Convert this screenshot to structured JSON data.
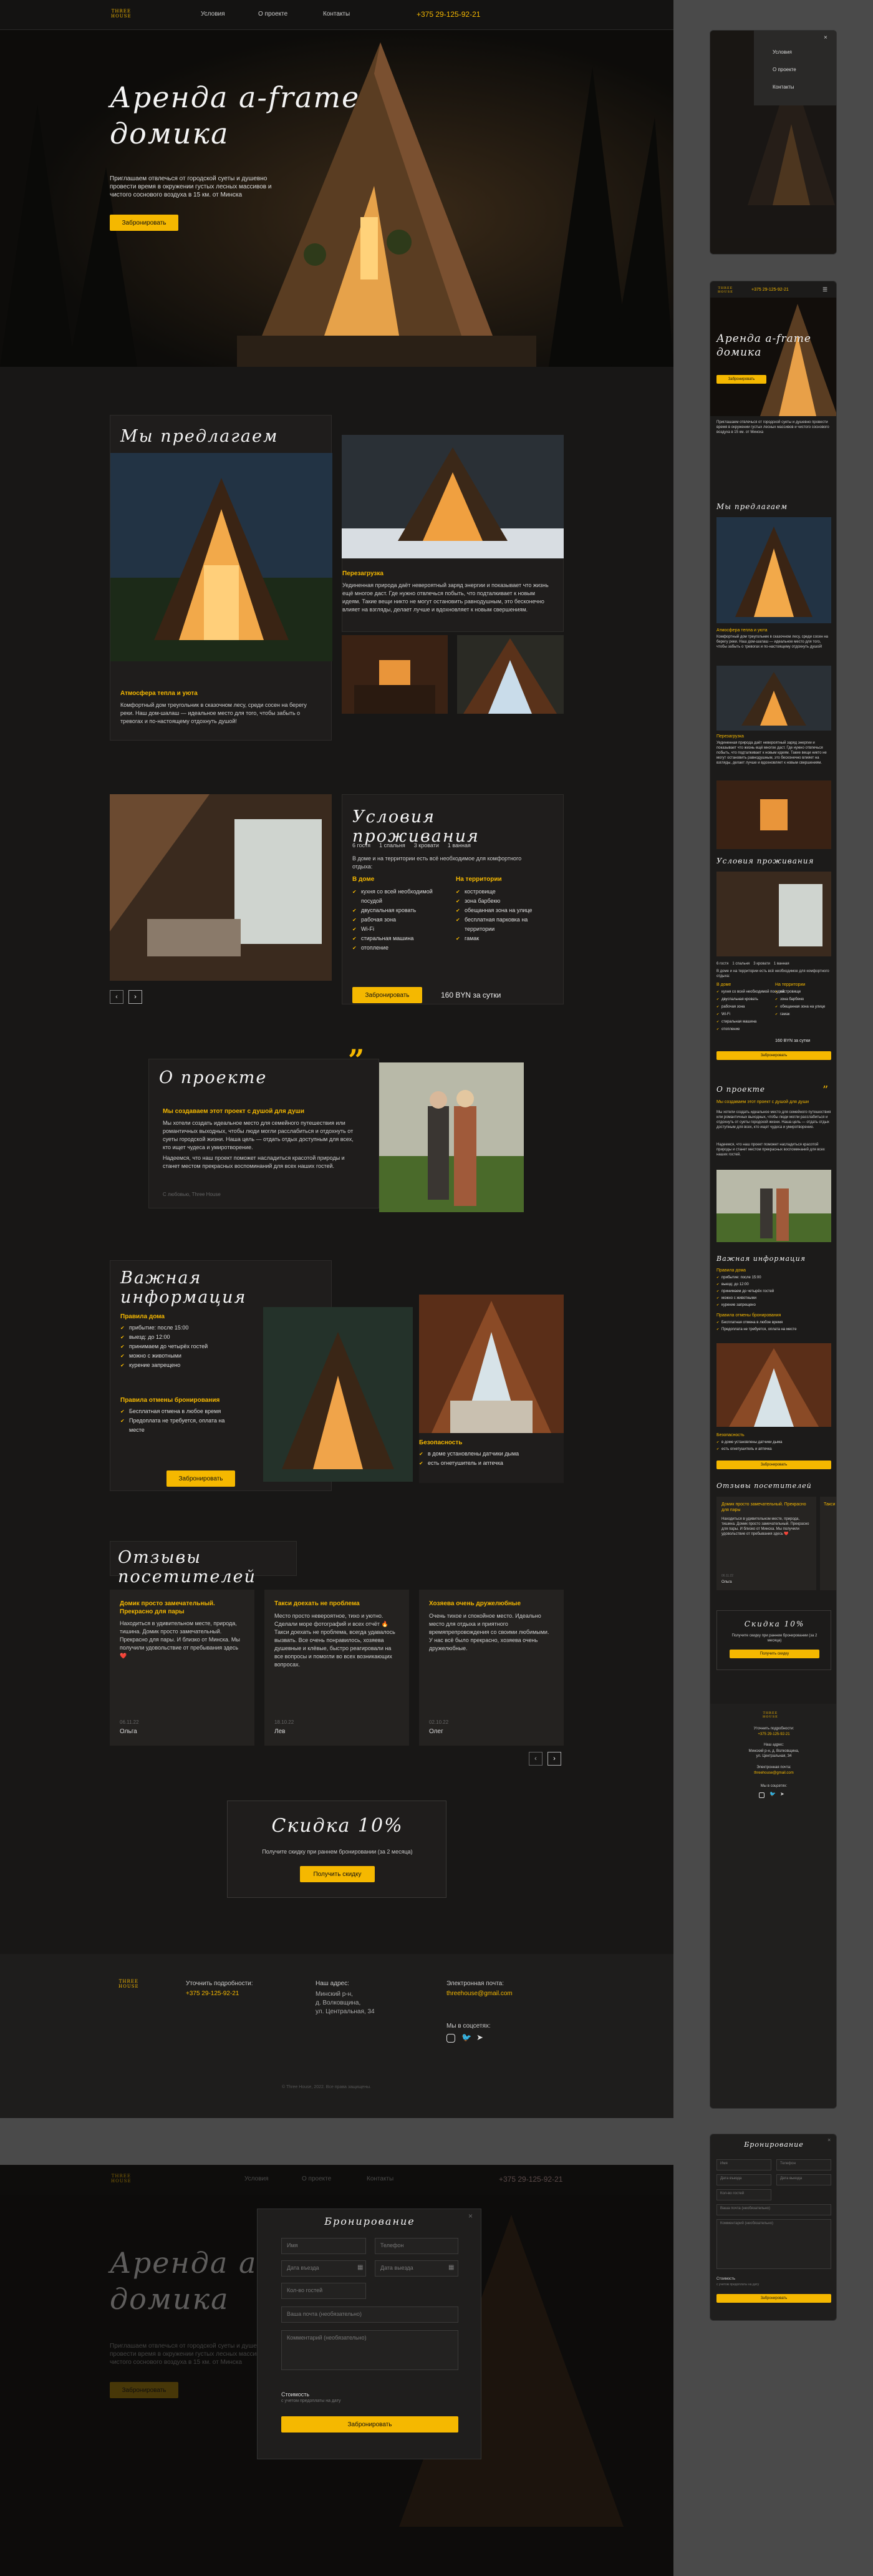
{
  "nav": {
    "logo_top": "THREE",
    "logo_bottom": "HOUSE",
    "links": [
      "Условия",
      "О проекте",
      "Контакты"
    ],
    "phone": "+375 29-125-92-21"
  },
  "hero": {
    "title_1": "Аренда a-frame",
    "title_2": "домика",
    "text": "Приглашаем отвлечься от городской суеты и душевно провести время в окружении густых лесных массивов и чистого соснового воздуха в 15 км. от Минска",
    "button": "Забронировать"
  },
  "offer": {
    "title": "Мы предлагаем",
    "card1_title": "Атмосфера тепла и уюта",
    "card1_text": "Комфортный дом треугольник в сказочном лесу, среди сосен на берегу реки. Наш дом-шалаш — идеальное место для того, чтобы забыть о тревогах и по-настоящему отдохнуть душой!",
    "card2_title": "Перезагрузка",
    "card2_text": "Уединенная природа даёт невероятный заряд энергии и показывает что жизнь ещё многое даст. Где нужно отвлечься побыть, что подталкивает к новым идеям. Такие вещи никто не могут остановить равнодушным, это бесконечно влияет на взгляды, делает лучше и вдохновляет к новым свершениям."
  },
  "conditions": {
    "title": "Условия проживания",
    "stats": [
      "6 гостя",
      "1 спальня",
      "3 кровати",
      "1 ванная"
    ],
    "intro": "В доме и на территории есть всё необходимое для комфортного отдыха:",
    "col1_title": "В доме",
    "col1": [
      "кухня со всей необходимой посудой",
      "двуспальная кровать",
      "рабочая зона",
      "Wi-Fi",
      "стиральная машина",
      "отопление"
    ],
    "col2_title": "На территории",
    "col2": [
      "костровище",
      "зона барбекю",
      "обещанная зона на улице",
      "бесплатная парковка на территории",
      "гамак"
    ],
    "button": "Забронировать",
    "price": "160 BYN за сутки"
  },
  "about": {
    "title": "О проекте",
    "subtitle": "Мы создаваем этот проект с душой для души",
    "p1": "Мы хотели создать идеальное место для семейного путешествия или романтичных выходных, чтобы люди могли расслабиться и отдохнуть от суеты городской жизни. Наша цель — отдать отдых доступным для всех, кто ищет чудеса и умиротворение.",
    "p2": "Надеемся, что наш проект поможет насладиться красотой природы и станет местом прекрасных воспоминаний для всех наших гостей.",
    "sign": "С любовью, Three House"
  },
  "info": {
    "title": "Важная информация",
    "rules_title": "Правила дома",
    "rules": [
      "прибытие: после 15:00",
      "выезд: до 12:00",
      "принимаем до четырёх гостей",
      "можно с животными",
      "курение запрещено"
    ],
    "cancel_title": "Правила отмены бронирования",
    "cancel": [
      "Бесплатная отмена в любое время",
      "Предоплата не требуется, оплата на месте"
    ],
    "button": "Забронировать",
    "safety_title": "Безопасность",
    "safety": [
      "в доме установлены датчики дыма",
      "есть огнетушитель и аптечка"
    ]
  },
  "reviews": {
    "title": "Отзывы посетителей",
    "items": [
      {
        "title": "Домик просто замечательный. Прекрасно для пары",
        "text": "Находиться в удивительном месте, природа, тишина. Домик просто замечательный. Прекрасно для пары. И близко от Минска. Мы получили удовольствие от пребывания здесь ❤️",
        "date": "06.11.22",
        "name": "Ольга"
      },
      {
        "title": "Такси доехать не проблема",
        "text": "Место просто невероятное, тихо и уютно. Сделали море фотографий и всех отчёт 🔥 Такси доехать не проблема, всегда удавалось вызвать. Все очень понравилось, хозяева душевные и клёвые, быстро реагировали на все вопросы и помогли во всех возникающих вопросах.",
        "date": "18.10.22",
        "name": "Лев"
      },
      {
        "title": "Хозяева очень дружелюбные",
        "text": "Очень тихое и спокойное место. Идеально место для отдыха и приятного времяпрепровождения со своими любимыми. У нас всё было прекрасно, хозяева очень дружелюбные.",
        "date": "02.10.22",
        "name": "Олег"
      }
    ]
  },
  "discount": {
    "title": "Скидка 10%",
    "text": "Получите скидку при раннем бронировании (за 2 месяца)",
    "button": "Получить скидку"
  },
  "footer": {
    "details_label": "Уточнить подробности:",
    "phone": "+375 29-125-92-21",
    "address_label": "Наш адрес:",
    "address": [
      "Минский р-н,",
      "д. Волковщина,",
      "ул. Центральная, 34"
    ],
    "email_label": "Электронная почта:",
    "email": "threehouse@gmail.com",
    "social_label": "Мы в соцсетях:",
    "copyright": "© Three House, 2022. Все права защищены."
  },
  "booking": {
    "title": "Бронирование",
    "fields": [
      "Имя",
      "Телефон",
      "Дата въезда",
      "Дата выезда",
      "Кол-во гостей",
      "Ваша почта (необязательно)",
      "Комментарий (необязательно)"
    ],
    "cost_label": "Стоимость",
    "cost_note": "с учетом предоплаты на дату",
    "button": "Забронировать"
  },
  "mobile": {
    "menu": [
      "Условия",
      "О проекте",
      "Контакты"
    ],
    "info_title": "Важная информация",
    "reviews_title": "Отзывы посетителей",
    "discount_title": "Скидка 10%"
  },
  "colors": {
    "accent": "#f5b800",
    "bg": "#181716",
    "card": "#1f1d1c"
  }
}
